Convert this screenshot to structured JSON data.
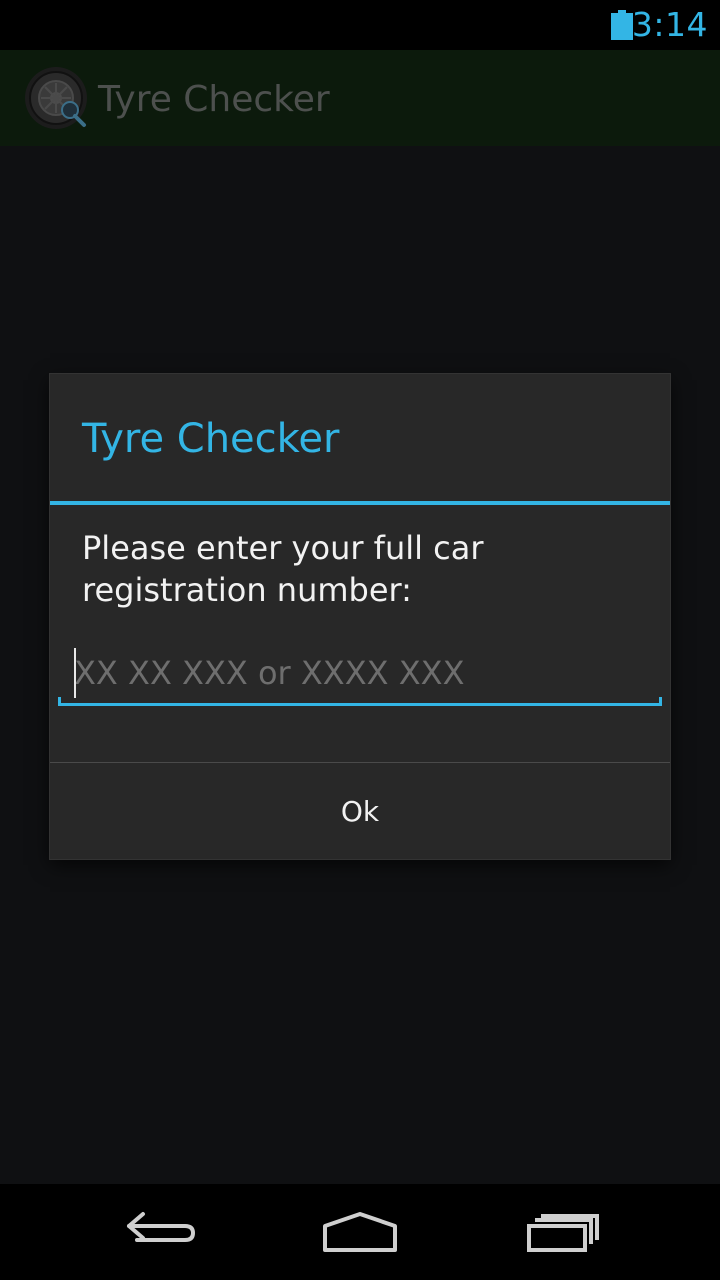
{
  "status_bar": {
    "time": "3:14",
    "battery_icon": "battery-full-icon"
  },
  "action_bar": {
    "title": "Tyre Checker",
    "app_icon": "tyre-magnifier-icon"
  },
  "dialog": {
    "title": "Tyre Checker",
    "message": "Please enter your full car registration number:",
    "input": {
      "value": "",
      "placeholder": "XX XX XXX or XXXX XXX"
    },
    "ok_label": "Ok"
  },
  "nav_bar": {
    "back_icon": "back-icon",
    "home_icon": "home-icon",
    "recents_icon": "recent-apps-icon"
  },
  "colors": {
    "accent": "#33b5e5",
    "dialog_background": "#282828",
    "action_bar_background": "#0c1a0c"
  }
}
